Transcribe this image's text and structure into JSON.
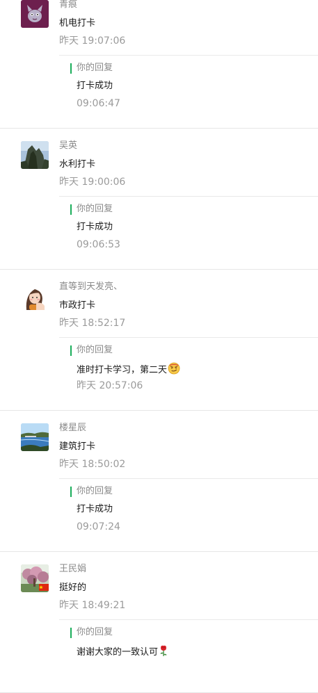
{
  "messages": [
    {
      "avatar": "cartoon-cat-avatar",
      "name": "青痕",
      "content": "机电打卡",
      "time": "昨天 19:07:06",
      "reply": {
        "label": "你的回复",
        "text": "打卡成功",
        "time": "09:06:47"
      }
    },
    {
      "avatar": "mountain-cliff-avatar",
      "name": "吴英",
      "content": "水利打卡",
      "time": "昨天 19:00:06",
      "reply": {
        "label": "你的回复",
        "text": "打卡成功",
        "time": "09:06:53"
      }
    },
    {
      "avatar": "cartoon-girl-avatar",
      "name": "直等到天发亮、",
      "content": "市政打卡",
      "time": "昨天 18:52:17",
      "reply": {
        "label": "你的回复",
        "text": "准时打卡学习，第二天",
        "emoji": "smirk-emoji",
        "time": "昨天 20:57:06"
      }
    },
    {
      "avatar": "lake-landscape-avatar",
      "name": "楼星辰",
      "content": "建筑打卡",
      "time": "昨天 18:50:02",
      "reply": {
        "label": "你的回复",
        "text": "打卡成功",
        "time": "09:07:24"
      }
    },
    {
      "avatar": "flower-tree-flag-avatar",
      "name": "王民娟",
      "content": "挺好的",
      "time": "昨天 18:49:21",
      "reply": {
        "label": "你的回复",
        "text": "谢谢大家的一致认可",
        "emoji": "rose-emoji",
        "time": ""
      }
    }
  ],
  "colors": {
    "accent_bar": "#1aad5a",
    "muted_text": "#8a8a8a",
    "divider": "#e6e6e6"
  }
}
